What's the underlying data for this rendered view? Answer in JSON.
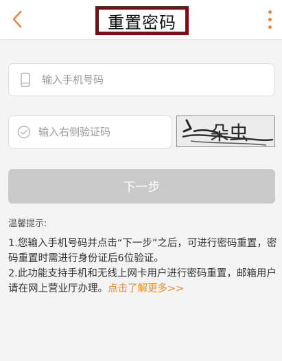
{
  "header": {
    "title": "重置密码",
    "back_icon": "chevron-left-icon",
    "more_icon": "vertical-dots-icon"
  },
  "form": {
    "phone_placeholder": "输入手机号码",
    "phone_icon": "phone-icon",
    "code_placeholder": "输入右侧验证码",
    "code_icon": "check-circle-icon",
    "captcha_text": "朵虫",
    "next_label": "下一步"
  },
  "tips": {
    "title": "温馨提示:",
    "line1": "1.您输入手机号码并点击“下一步”之后，可进行密码重置，密码重置时需进行身份证后6位验证。",
    "line2": "2.此功能支持手机和无线上网卡用户进行密码重置，邮箱用户请在网上营业厅办理。",
    "link": "点击了解更多>>"
  },
  "colors": {
    "accent": "#e8843f",
    "link": "#f08a2a",
    "title_border": "#7a0f15",
    "button_disabled": "#c9c9c9",
    "background": "#f4f4f4"
  }
}
